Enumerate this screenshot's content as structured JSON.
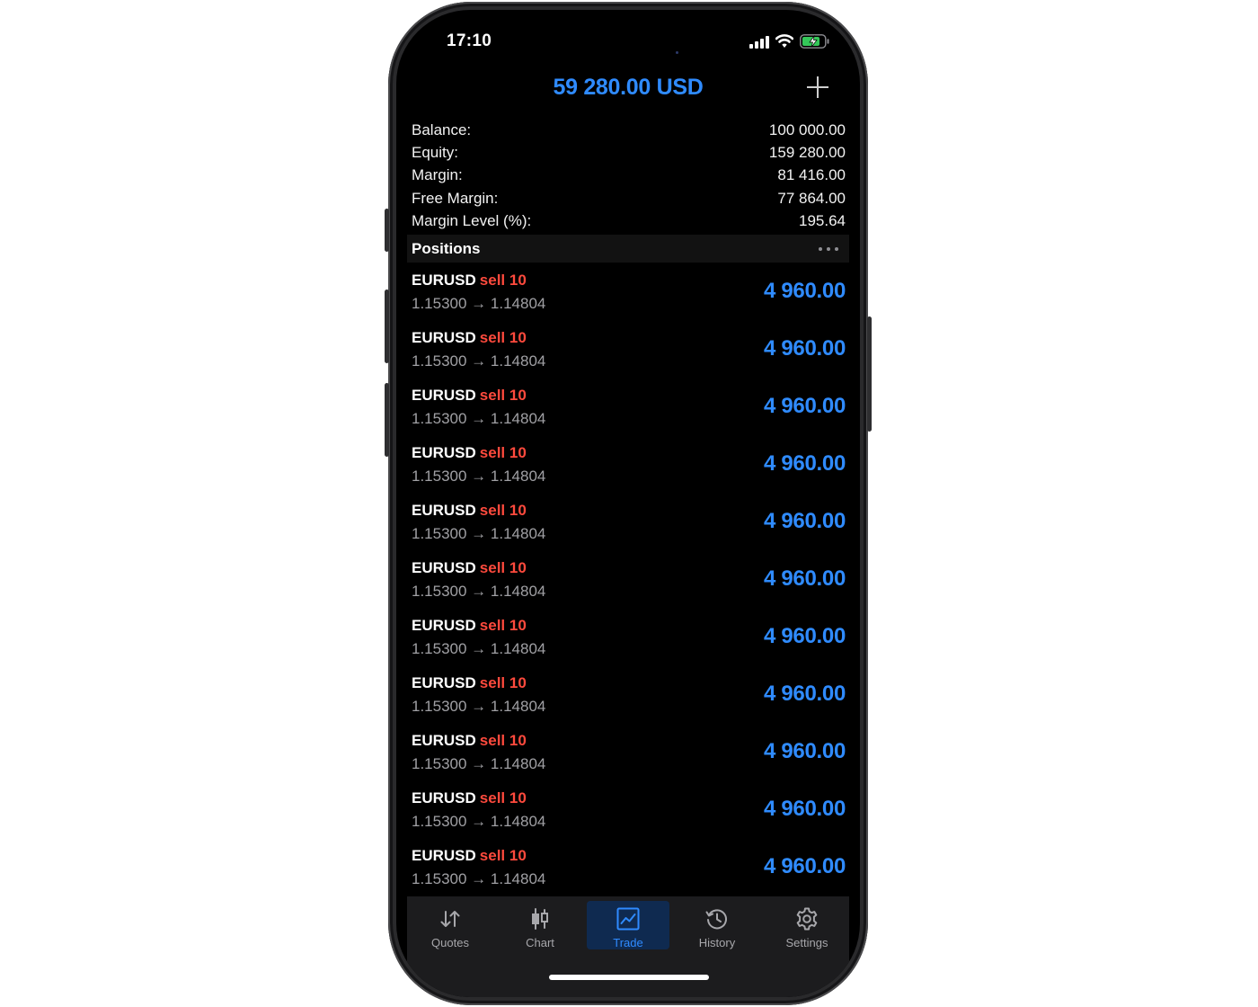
{
  "status_bar": {
    "time": "17:10"
  },
  "header": {
    "title": "59 280.00 USD",
    "add_icon": "plus-icon"
  },
  "summary": [
    {
      "label": "Balance:",
      "value": "100 000.00"
    },
    {
      "label": "Equity:",
      "value": "159 280.00"
    },
    {
      "label": "Margin:",
      "value": "81 416.00"
    },
    {
      "label": "Free Margin:",
      "value": "77 864.00"
    },
    {
      "label": "Margin Level (%):",
      "value": "195.64"
    }
  ],
  "positions": {
    "title": "Positions",
    "items": [
      {
        "symbol": "EURUSD",
        "side": "sell 10",
        "prices": "1.15300 → 1.14804",
        "profit": "4 960.00"
      },
      {
        "symbol": "EURUSD",
        "side": "sell 10",
        "prices": "1.15300 → 1.14804",
        "profit": "4 960.00"
      },
      {
        "symbol": "EURUSD",
        "side": "sell 10",
        "prices": "1.15300 → 1.14804",
        "profit": "4 960.00"
      },
      {
        "symbol": "EURUSD",
        "side": "sell 10",
        "prices": "1.15300 → 1.14804",
        "profit": "4 960.00"
      },
      {
        "symbol": "EURUSD",
        "side": "sell 10",
        "prices": "1.15300 → 1.14804",
        "profit": "4 960.00"
      },
      {
        "symbol": "EURUSD",
        "side": "sell 10",
        "prices": "1.15300 → 1.14804",
        "profit": "4 960.00"
      },
      {
        "symbol": "EURUSD",
        "side": "sell 10",
        "prices": "1.15300 → 1.14804",
        "profit": "4 960.00"
      },
      {
        "symbol": "EURUSD",
        "side": "sell 10",
        "prices": "1.15300 → 1.14804",
        "profit": "4 960.00"
      },
      {
        "symbol": "EURUSD",
        "side": "sell 10",
        "prices": "1.15300 → 1.14804",
        "profit": "4 960.00"
      },
      {
        "symbol": "EURUSD",
        "side": "sell 10",
        "prices": "1.15300 → 1.14804",
        "profit": "4 960.00"
      },
      {
        "symbol": "EURUSD",
        "side": "sell 10",
        "prices": "1.15300 → 1.14804",
        "profit": "4 960.00"
      }
    ]
  },
  "tabs": [
    {
      "label": "Quotes",
      "icon": "quotes-icon",
      "active": false
    },
    {
      "label": "Chart",
      "icon": "candlestick-chart-icon",
      "active": false
    },
    {
      "label": "Trade",
      "icon": "trade-icon",
      "active": true
    },
    {
      "label": "History",
      "icon": "history-icon",
      "active": false
    },
    {
      "label": "Settings",
      "icon": "settings-gear-icon",
      "active": false
    }
  ],
  "colors": {
    "accent": "#2f8bff",
    "sell": "#ff4a3d",
    "background": "#000000",
    "tabbar": "#1c1c1e",
    "active_tab": "#0f2a50"
  }
}
